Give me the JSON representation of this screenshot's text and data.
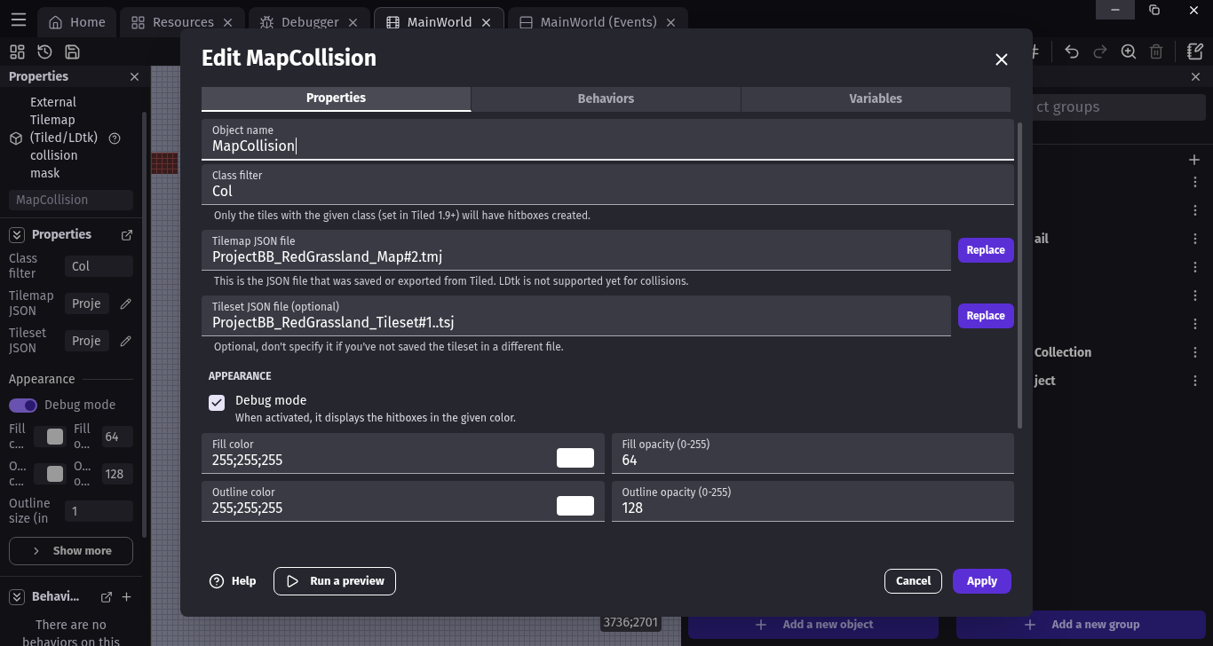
{
  "tabs": [
    {
      "label": "Home",
      "selected": false,
      "closable": false
    },
    {
      "label": "Resources",
      "selected": false,
      "closable": true
    },
    {
      "label": "Debugger",
      "selected": false,
      "closable": true
    },
    {
      "label": "MainWorld",
      "selected": true,
      "closable": true
    },
    {
      "label": "MainWorld (Events)",
      "selected": false,
      "closable": true
    }
  ],
  "properties_panel": {
    "title": "Properties",
    "object_type": "External Tilemap (Tiled/LDtk) collision mask",
    "object_name": "MapCollision",
    "section_title": "Properties",
    "rows": [
      {
        "label": "Class filter",
        "value": "Col",
        "kind": "text"
      },
      {
        "label": "Tilemap JSON",
        "value": "Proje",
        "kind": "file"
      },
      {
        "label": "Tileset JSON",
        "value": "Proje",
        "kind": "file"
      }
    ],
    "appearance_title": "Appearance",
    "toggle": {
      "label": "Debug mode",
      "on": true
    },
    "color_rows": [
      {
        "color_label": "Fill c...",
        "opacity_label": "Fill o...",
        "opacity": "64"
      },
      {
        "color_label": "O... c...",
        "opacity_label": "O... o...",
        "opacity": "128"
      }
    ],
    "outline": {
      "label": "Outline size (in",
      "value": "1"
    },
    "show_more": "Show more",
    "behaviors_title": "Behavi...",
    "behaviors_empty": "There are no behaviors on this"
  },
  "canvas": {
    "coordinates": "3736;2701"
  },
  "objects_panel": {
    "search_placeholder": "ct groups",
    "rows": [
      {
        "kind": "covered"
      },
      {
        "kind": "covered"
      },
      {
        "kind": "labeled",
        "label": "ail"
      },
      {
        "kind": "covered"
      },
      {
        "kind": "covered"
      },
      {
        "kind": "covered"
      },
      {
        "kind": "labeled",
        "label": "Collection"
      },
      {
        "kind": "labeled",
        "label": "ject"
      }
    ],
    "add_object": "Add a new object",
    "add_group": "Add a new group"
  },
  "dialog": {
    "title": "Edit MapCollision",
    "tabs": [
      {
        "label": "Properties",
        "selected": true
      },
      {
        "label": "Behaviors",
        "selected": false
      },
      {
        "label": "Variables",
        "selected": false
      }
    ],
    "fields": [
      {
        "label": "Object name",
        "value": "MapCollision",
        "focused": true
      },
      {
        "label": "Class filter",
        "value": "Col",
        "focused": false,
        "help": "Only the tiles with the given class (set in Tiled 1.9+) will have hitboxes created."
      },
      {
        "label": "Tilemap JSON file",
        "value": "ProjectBB_RedGrassland_Map#2.tmj",
        "focused": false,
        "button": "Replace",
        "help": "This is the JSON file that was saved or exported from Tiled. LDtk is not supported yet for collisions."
      },
      {
        "label": "Tileset JSON file (optional)",
        "value": "ProjectBB_RedGrassland_Tileset#1..tsj",
        "focused": false,
        "button": "Replace",
        "help": "Optional, don't specify it if you've not saved the tileset in a different file."
      }
    ],
    "section": "APPEARANCE",
    "checkbox": {
      "label": "Debug mode",
      "description": "When activated, it displays the hitboxes in the given color.",
      "checked": true
    },
    "grid": [
      {
        "label": "Fill color",
        "value": "255;255;255",
        "kind": "color"
      },
      {
        "label": "Fill opacity (0-255)",
        "value": "64",
        "kind": "number"
      },
      {
        "label": "Outline color",
        "value": "255;255;255",
        "kind": "color"
      },
      {
        "label": "Outline opacity (0-255)",
        "value": "128",
        "kind": "number"
      }
    ],
    "help": "Help",
    "preview": "Run a preview",
    "cancel": "Cancel",
    "apply": "Apply"
  }
}
